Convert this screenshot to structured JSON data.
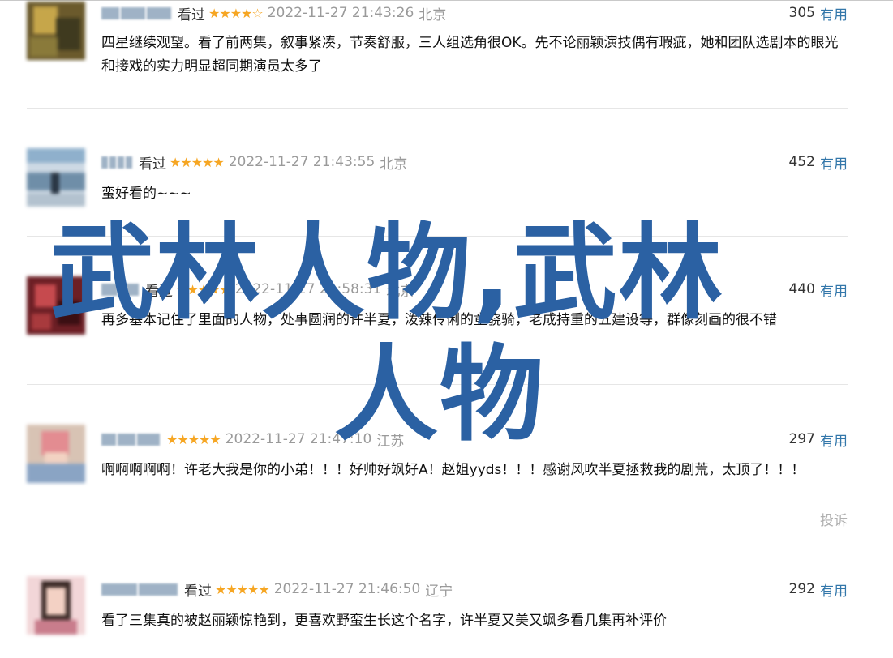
{
  "ui": {
    "watched_label": "看过",
    "useful_label": "有用",
    "report_label": "投诉",
    "star_color": "#f6a623",
    "link_color": "#3377aa"
  },
  "comments": [
    {
      "stars": "★★★★☆",
      "rating": 4,
      "datetime": "2022-11-27 21:43:26",
      "location": "北京",
      "votes": "305",
      "text": "四星继续观望。看了前两集，叙事紧凑，节奏舒服，三人组选角很OK。先不论丽颖演技偶有瑕疵，她和团队选剧本的眼光和接戏的实力明显超同期演员太多了"
    },
    {
      "stars": "★★★★★",
      "rating": 5,
      "datetime": "2022-11-27 21:43:55",
      "location": "北京",
      "votes": "452",
      "text": "蛮好看的~~~"
    },
    {
      "stars": "★★★★★",
      "rating": 5,
      "datetime": "2022-11-27 21:58:31",
      "location": "北京",
      "votes": "440",
      "text": "再多基本记住了里面的人物，处事圆润的许半夏，泼辣伶俐的童骁骑，老成持重的五建设等，群像刻画的很不错"
    },
    {
      "stars": "★★★★★",
      "rating": 5,
      "datetime": "2022-11-27 21:47:10",
      "location": "江苏",
      "votes": "297",
      "text": "啊啊啊啊啊！许老大我是你的小弟！！！好帅好飒好A！赵姐yyds！！！感谢风吹半夏拯救我的剧荒，太顶了！！！"
    },
    {
      "stars": "★★★★★",
      "rating": 5,
      "datetime": "2022-11-27 21:46:50",
      "location": "辽宁",
      "votes": "292",
      "text": "看了三集真的被赵丽颖惊艳到，更喜欢野蛮生长这个名字，许半夏又美又飒多看几集再补评价"
    }
  ],
  "overlay": {
    "line1": "武林人物,武林",
    "line2": "人物"
  }
}
